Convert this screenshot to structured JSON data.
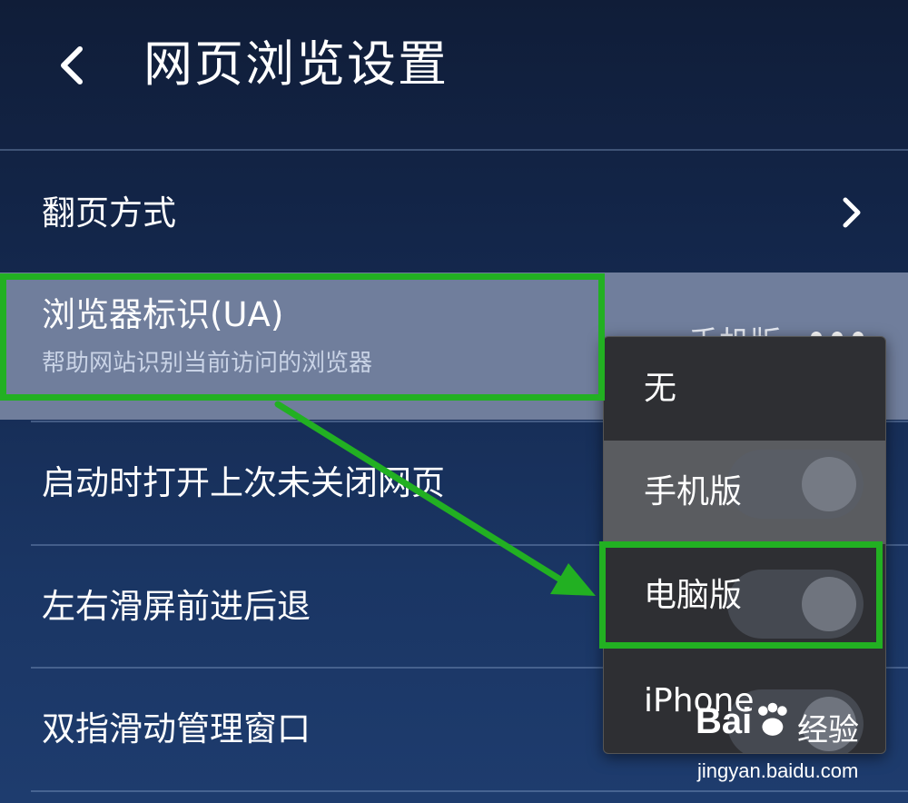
{
  "header": {
    "title": "网页浏览设置",
    "back_icon": "chevron-left-icon"
  },
  "settings": {
    "page_turn": {
      "label": "翻页方式",
      "icon": "chevron-right-icon"
    },
    "ua": {
      "label": "浏览器标识(UA)",
      "description": "帮助网站识别当前访问的浏览器",
      "value": "手机版",
      "icon": "more-icon"
    },
    "restore_tabs": {
      "label": "启动时打开上次未关闭网页"
    },
    "swipe_nav": {
      "label": "左右滑屏前进后退"
    },
    "two_finger": {
      "label": "双指滑动管理窗口"
    }
  },
  "ua_dropdown": {
    "options": [
      {
        "label": "无"
      },
      {
        "label": "手机版"
      },
      {
        "label": "电脑版"
      },
      {
        "label": "iPhone"
      }
    ],
    "selected_index": 1
  },
  "annotation": {
    "color": "#22b022"
  },
  "watermark": {
    "brand": "Bai",
    "brand_cn": "经验",
    "url": "jingyan.baidu.com"
  }
}
